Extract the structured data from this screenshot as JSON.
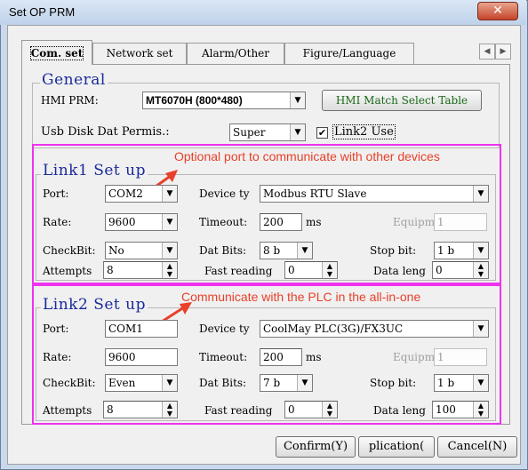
{
  "window": {
    "title": "Set OP PRM",
    "close_glyph": "✕"
  },
  "tabs": [
    {
      "label": "Com. set",
      "active": true
    },
    {
      "label": "Network set"
    },
    {
      "label": "Alarm/Other"
    },
    {
      "label": "Figure/Language"
    }
  ],
  "tab_scroll": {
    "left": "◀",
    "right": "▶"
  },
  "general": {
    "title": "General",
    "hmi_prm_label": "HMI PRM:",
    "hmi_model": "MT6070H (800*480)",
    "match_button": "HMI Match Select Table",
    "usb_label": "Usb Disk Dat Permis.:",
    "usb_value": "Super",
    "link2_use_label": "Link2 Use",
    "link2_use_checked": "✔"
  },
  "link1": {
    "title": "Link1 Set up",
    "annotation": "Optional port to communicate with other devices",
    "port_label": "Port:",
    "port_value": "COM2",
    "device_label": "Device ty",
    "device_value": "Modbus RTU Slave",
    "rate_label": "Rate:",
    "rate_value": "9600",
    "timeout_label": "Timeout:",
    "timeout_value": "200",
    "ms": "ms",
    "equipment_label": "Equipment",
    "equipment_value": "1",
    "checkbit_label": "CheckBit:",
    "checkbit_value": "No",
    "datbits_label": "Dat Bits:",
    "datbits_value": "8 b",
    "stopbit_label": "Stop bit:",
    "stopbit_value": "1 b",
    "attempts_label": "Attempts",
    "attempts_value": "8",
    "fast_label": "Fast reading",
    "fast_value": "0",
    "datalen_label": "Data leng",
    "datalen_value": "0"
  },
  "link2": {
    "title": "Link2 Set up",
    "annotation": "Communicate with the PLC in the all-in-one",
    "port_label": "Port:",
    "port_value": "COM1",
    "device_label": "Device ty",
    "device_value": "CoolMay PLC(3G)/FX3UC",
    "rate_label": "Rate:",
    "rate_value": "9600",
    "timeout_label": "Timeout:",
    "timeout_value": "200",
    "ms": "ms",
    "equipment_label": "Equipment",
    "equipment_value": "1",
    "checkbit_label": "CheckBit:",
    "checkbit_value": "Even",
    "datbits_label": "Dat Bits:",
    "datbits_value": "7 b",
    "stopbit_label": "Stop bit:",
    "stopbit_value": "1 b",
    "attempts_label": "Attempts",
    "attempts_value": "8",
    "fast_label": "Fast reading",
    "fast_value": "0",
    "datalen_label": "Data leng",
    "datalen_value": "100"
  },
  "footer": {
    "confirm": "Confirm(Y)",
    "application": "plication(",
    "cancel": "Cancel(N)"
  },
  "glyphs": {
    "dropdown": "▼",
    "spin_up": "▲",
    "spin_down": "▼"
  },
  "colors": {
    "annotation": "#e8402a",
    "highlight_box": "#ee33ee",
    "section_title": "#1a2a9a"
  }
}
